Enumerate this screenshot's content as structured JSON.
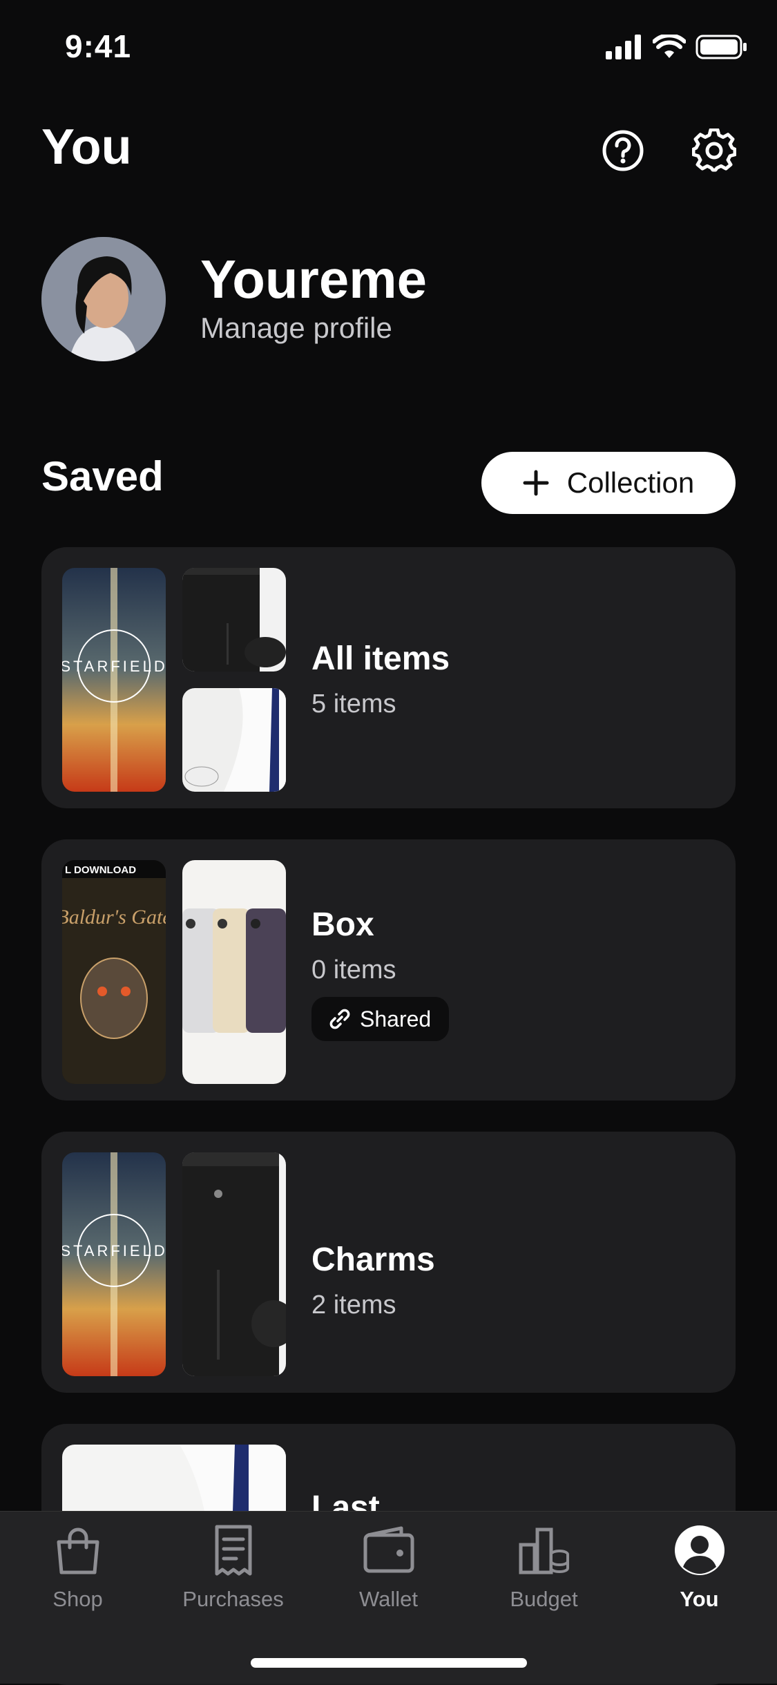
{
  "status": {
    "time": "9:41"
  },
  "header": {
    "title": "You"
  },
  "profile": {
    "name": "Youreme",
    "subtitle": "Manage profile"
  },
  "saved": {
    "title": "Saved",
    "add_button_label": "Collection",
    "collections": [
      {
        "title": "All items",
        "count": "5 items"
      },
      {
        "title": "Box",
        "count": "0 items",
        "badge": "Shared"
      },
      {
        "title": "Charms",
        "count": "2 items"
      },
      {
        "title": "Last"
      }
    ]
  },
  "thumb_text": {
    "download": "L DOWNLOAD",
    "starfield": "STARFIELD",
    "baldurs": "Baldur's Gate"
  },
  "tabs": [
    {
      "label": "Shop",
      "icon": "shopping-bag-icon"
    },
    {
      "label": "Purchases",
      "icon": "receipt-icon"
    },
    {
      "label": "Wallet",
      "icon": "wallet-icon"
    },
    {
      "label": "Budget",
      "icon": "budget-icon"
    },
    {
      "label": "You",
      "icon": "user-circle-icon",
      "active": true
    }
  ]
}
